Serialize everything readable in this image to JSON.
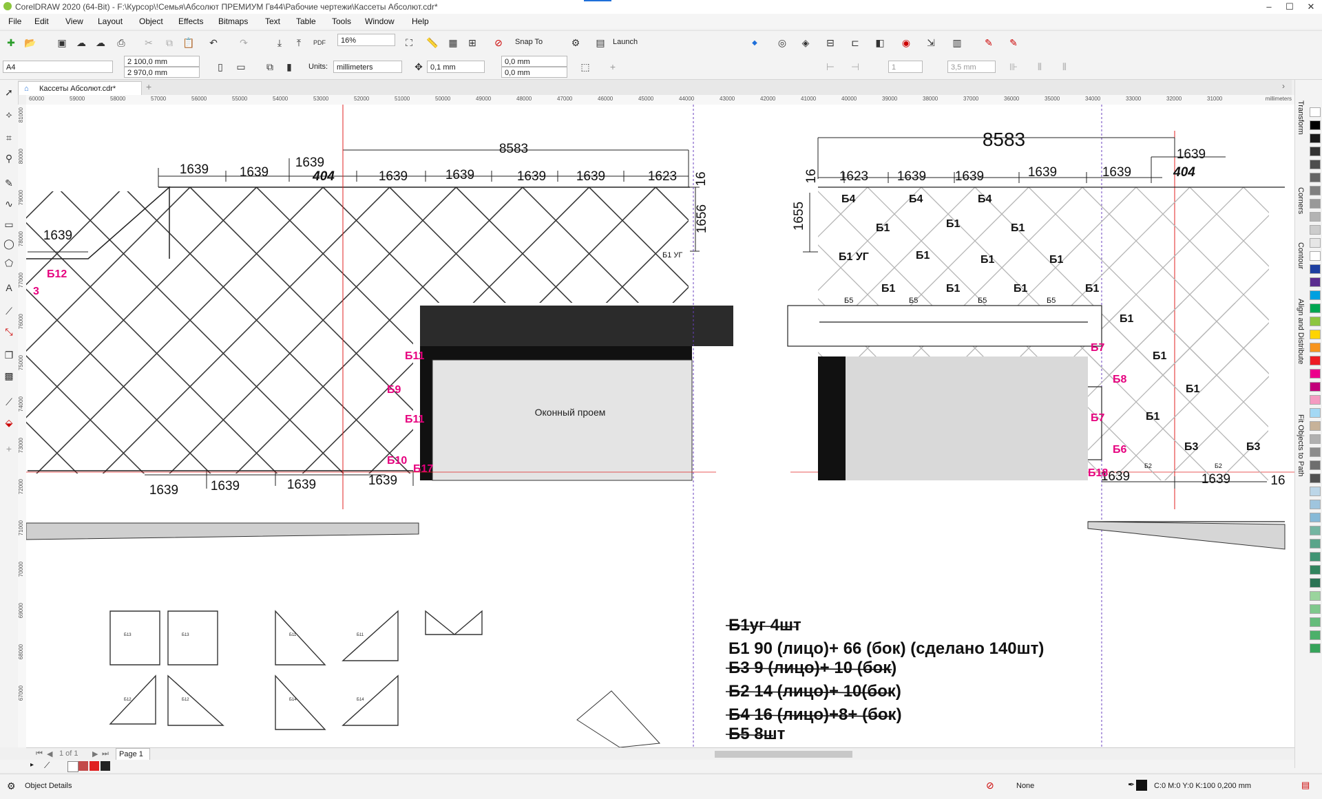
{
  "window": {
    "title": "CorelDRAW 2020 (64-Bit) - F:\\Курсор\\!Семья\\Абсолют ПРЕМИУМ Гв44\\Рабочие чертежи\\Кассеты Абсолют.cdr*",
    "min": "–",
    "max": "☐",
    "close": "✕"
  },
  "menu": [
    "File",
    "Edit",
    "View",
    "Layout",
    "Object",
    "Effects",
    "Bitmaps",
    "Text",
    "Table",
    "Tools",
    "Window",
    "Help"
  ],
  "toolbar": {
    "zoom": "16%",
    "snap_to": "Snap To",
    "launch": "Launch"
  },
  "propertybar": {
    "page_size": "A4",
    "width": "2 100,0 mm",
    "height": "2 970,0 mm",
    "units_label": "Units:",
    "units": "millimeters",
    "nudge": "0,1 mm",
    "dup_x": "0,0 mm",
    "dup_y": "0,0 mm",
    "count": "1",
    "spacing": "3,5 mm"
  },
  "document_tab": "Кассеты Абсолют.cdr*",
  "ruler": {
    "ticks": [
      "60000",
      "59000",
      "58000",
      "57000",
      "56000",
      "55000",
      "54000",
      "53000",
      "52000",
      "51000",
      "50000",
      "49000",
      "48000",
      "47000",
      "46000",
      "45000",
      "44000",
      "43000",
      "42000",
      "41000",
      "40000",
      "39000",
      "38000",
      "37000",
      "36000",
      "35000",
      "34000",
      "33000",
      "32000",
      "31000"
    ],
    "unit": "millimeters",
    "v_ticks": [
      "81000",
      "80000",
      "79000",
      "78000",
      "77000",
      "76000",
      "75000",
      "74000",
      "73000",
      "72000",
      "71000",
      "70000",
      "69000",
      "68000",
      "67000"
    ]
  },
  "drawing": {
    "left_dims_top": [
      "1639",
      "1639",
      "1639",
      "1639",
      "1639",
      "1639",
      "1639",
      "1623"
    ],
    "left_total": "8583",
    "left_special": "404",
    "left_side_top": "16",
    "left_side_dim": "1656",
    "left_wall_dim": "1639",
    "left_bottom_dims": [
      "1639",
      "1639",
      "1639",
      "1639"
    ],
    "left_labels": [
      "Б12",
      "3",
      "Б11",
      "Б9",
      "Б11",
      "Б10",
      "Б17"
    ],
    "left_corner": "Б1 УГ",
    "window_label": "Оконный проем",
    "right_total": "8583",
    "right_dims_top": [
      "1623",
      "1639",
      "1639",
      "1639",
      "1639",
      "1639"
    ],
    "right_special": "404",
    "right_side_top": "16",
    "right_side_dim": "1655",
    "right_bottom_dims": [
      "1639",
      "1639",
      "16"
    ],
    "right_b4": [
      "Б4",
      "Б4",
      "Б4"
    ],
    "right_b1": [
      "Б1",
      "Б1",
      "Б1",
      "Б1",
      "Б1",
      "Б1",
      "Б1",
      "Б1",
      "Б1",
      "Б1",
      "Б1",
      "Б1",
      "Б1",
      "Б1"
    ],
    "right_corner": "Б1 УГ",
    "right_b5": [
      "Б5",
      "Б5",
      "Б5",
      "Б5"
    ],
    "right_pink": [
      "Б7",
      "Б8",
      "Б7",
      "Б6",
      "Б18"
    ],
    "right_b3": [
      "Б3",
      "Б3"
    ],
    "right_b2": [
      "Б2",
      "Б2"
    ]
  },
  "notes": [
    {
      "text": "Б1уг  4шт",
      "struck": true
    },
    {
      "text": "Б1 90 (лицо)+ 66 (бок) (сделано 140шт)",
      "struck": false
    },
    {
      "text": "Б3 9 (лицо)+ 10 (бок)",
      "struck": true
    },
    {
      "text": "Б2 14 (лицо)+ 10(бок)",
      "struck": true
    },
    {
      "text": "Б4 16 (лицо)+8+ (бок)",
      "struck": true
    },
    {
      "text": "Б5 8шт",
      "struck": true
    }
  ],
  "thumbs": [
    "Б13",
    "Б13",
    "Б11",
    "Б11",
    "Б12",
    "Б12",
    "Б14",
    "Б14"
  ],
  "navigator": {
    "page_of": "1 of 1",
    "page_tab": "Page 1"
  },
  "dockers": [
    "Transform",
    "Corners",
    "Contour",
    "Align and Distribute",
    "Fit Objects to Path"
  ],
  "status": {
    "object_details": "Object Details",
    "fill": "None",
    "outline": "C:0 M:0 Y:0 K:100  0,200 mm"
  },
  "colors": {
    "accent": "#1e6fd9",
    "pink_label": "#e6007e",
    "guide_red": "#e02020",
    "guide_purple": "#6a3fbf",
    "window_dark": "#2b2b2b"
  },
  "palette": [
    "#ffffff",
    "#000000",
    "#1a1a1a",
    "#333333",
    "#4d4d4d",
    "#666666",
    "#808080",
    "#999999",
    "#b3b3b3",
    "#cccccc",
    "#e6e6e6",
    "#ffffff",
    "#1e3fa0",
    "#5b2d90",
    "#00a0e0",
    "#00a651",
    "#8dc63f",
    "#ffd400",
    "#f7941d",
    "#ed1c24",
    "#ec008c",
    "#c2007a",
    "#f49ac1",
    "#a3d8f4",
    "#c7b299",
    "#b0b0b0",
    "#8c8c8c",
    "#6e6e6e",
    "#515151",
    "#bcd6e8",
    "#9fc5de",
    "#86b9d7",
    "#74b5a1",
    "#5aa58a",
    "#3f9473",
    "#31845e",
    "#2a7454",
    "#9ad49d",
    "#7fc88c",
    "#65bc7b",
    "#4cb06a",
    "#36a35a"
  ]
}
